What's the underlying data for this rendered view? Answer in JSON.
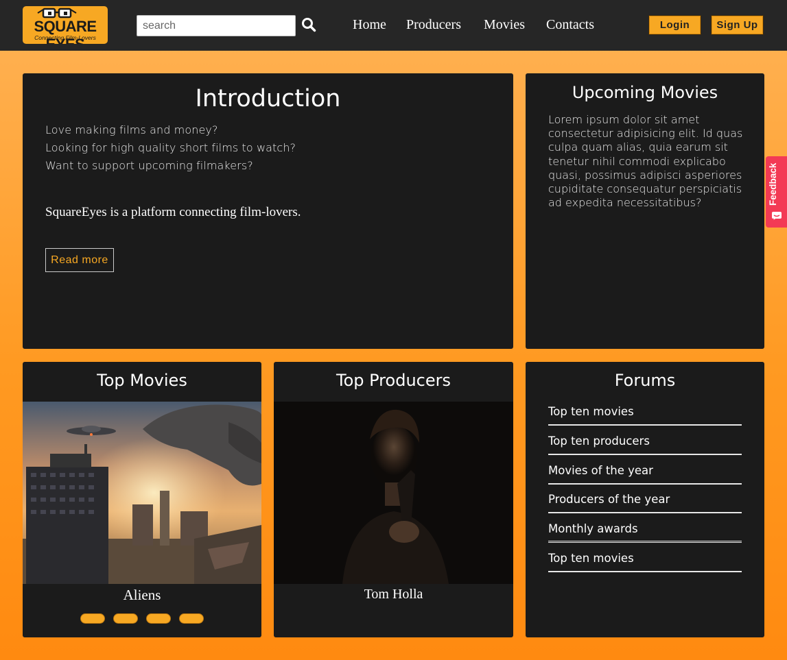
{
  "header": {
    "logo": {
      "title": "SQUARE EYES",
      "tagline": "Connecting Film-Lovers"
    },
    "search": {
      "placeholder": "search",
      "value": ""
    },
    "nav": [
      "Home",
      "Producers",
      "Movies",
      "Contacts"
    ],
    "login_label": "Login",
    "signup_label": "Sign Up"
  },
  "intro": {
    "title": "Introduction",
    "lines": [
      "Love making films and money?",
      "Looking for high quality short films to watch?",
      "Want to support upcoming filmakers?"
    ],
    "tagline": "SquareEyes is a platform connecting film-lovers.",
    "read_more": "Read more"
  },
  "upcoming": {
    "title": "Upcoming Movies",
    "text": "Lorem ipsum dolor sit amet consectetur adipisicing elit. Id quas culpa quam alias, quia earum sit tenetur nihil commodi explicabo quasi, possimus adipisci asperiores cupiditate consequatur perspiciatis ad expedita necessitatibus?"
  },
  "top_movies": {
    "title": "Top Movies",
    "caption": "Aliens",
    "carousel_count": 4
  },
  "top_producers": {
    "title": "Top Producers",
    "caption": "Tom Holla"
  },
  "forums": {
    "title": "Forums",
    "items": [
      "Top ten movies",
      "Top ten producers",
      "Movies of the year",
      "Producers of the year",
      "Monthly awards",
      "Top ten movies"
    ]
  },
  "feedback": {
    "label": "Feedback"
  },
  "colors": {
    "accent": "#f7a823",
    "card": "#1b1b1b",
    "header": "#262626",
    "feedback": "#f33a55"
  }
}
